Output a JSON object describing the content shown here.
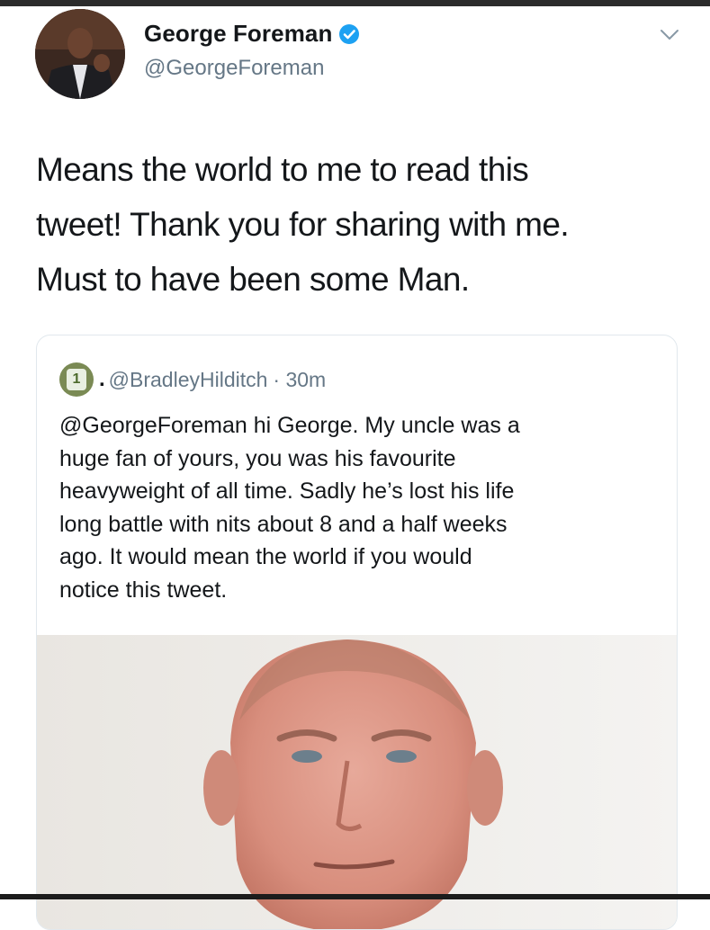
{
  "tweet": {
    "author": {
      "display_name": "George Foreman",
      "handle": "@GeorgeForeman",
      "verified": true
    },
    "text": "Means the world to me to read this\ntweet! Thank you for sharing with me.\nMust to have been some Man."
  },
  "quoted_tweet": {
    "separator": ".",
    "handle": "@BradleyHilditch",
    "time": "· 30m",
    "text": "@GeorgeForeman hi George. My uncle was a\nhuge fan of yours, you was his favourite\nheavyweight of all time. Sadly he’s lost his life\nlong battle with nits about 8 and a half weeks\nago. It would mean the world if you would\nnotice this tweet."
  },
  "icons": {
    "verified_badge": "verified-badge-icon",
    "menu": "chevron-down-icon"
  },
  "colors": {
    "verified_blue": "#1da1f2",
    "secondary_text": "#657786",
    "primary_text": "#14171a"
  }
}
